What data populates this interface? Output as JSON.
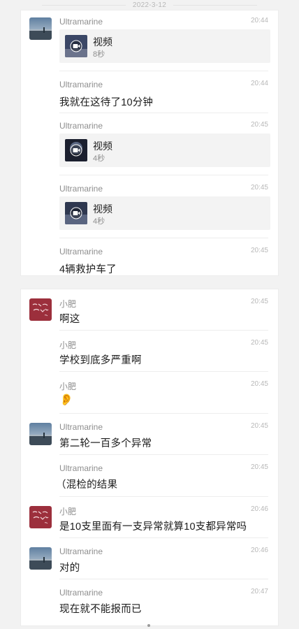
{
  "date_divider": "2022-3-12",
  "group1": {
    "messages": [
      {
        "sender": "Ultramarine",
        "time": "20:44",
        "video_label": "视频",
        "video_duration": "8秒"
      },
      {
        "sender": "Ultramarine",
        "time": "20:44",
        "text": "我就在这待了10分钟"
      },
      {
        "sender": "Ultramarine",
        "time": "20:45",
        "video_label": "视频",
        "video_duration": "4秒"
      },
      {
        "sender": "Ultramarine",
        "time": "20:45",
        "video_label": "视频",
        "video_duration": "4秒"
      },
      {
        "sender": "Ultramarine",
        "time": "20:45",
        "text": "4辆救护车了"
      }
    ]
  },
  "group2": {
    "messages": [
      {
        "sender": "小肥",
        "time": "20:45",
        "text": "啊这"
      },
      {
        "sender": "小肥",
        "time": "20:45",
        "text": "学校到底多严重啊"
      },
      {
        "sender": "小肥",
        "time": "20:45",
        "emoji": "👂"
      },
      {
        "sender": "Ultramarine",
        "time": "20:45",
        "text": "第二轮一百多个异常"
      },
      {
        "sender": "Ultramarine",
        "time": "20:45",
        "text": "（混检的结果"
      },
      {
        "sender": "小肥",
        "time": "20:46",
        "text": "是10支里面有一支异常就算10支都异常吗"
      },
      {
        "sender": "Ultramarine",
        "time": "20:46",
        "text": "对的"
      },
      {
        "sender": "Ultramarine",
        "time": "20:47",
        "text": "现在就不能报而已"
      }
    ]
  },
  "colors": {
    "background": "#f2f2f2",
    "card": "#ffffff",
    "video_bubble": "#f3f3f3",
    "xiaofei_avatar": "#9c2f3c"
  },
  "icons": {
    "ultramarine_avatar": "seaside-photo-avatar",
    "xiaofei_avatar": "red-calligraphy-avatar",
    "video_thumb": "video-camera-icon"
  }
}
